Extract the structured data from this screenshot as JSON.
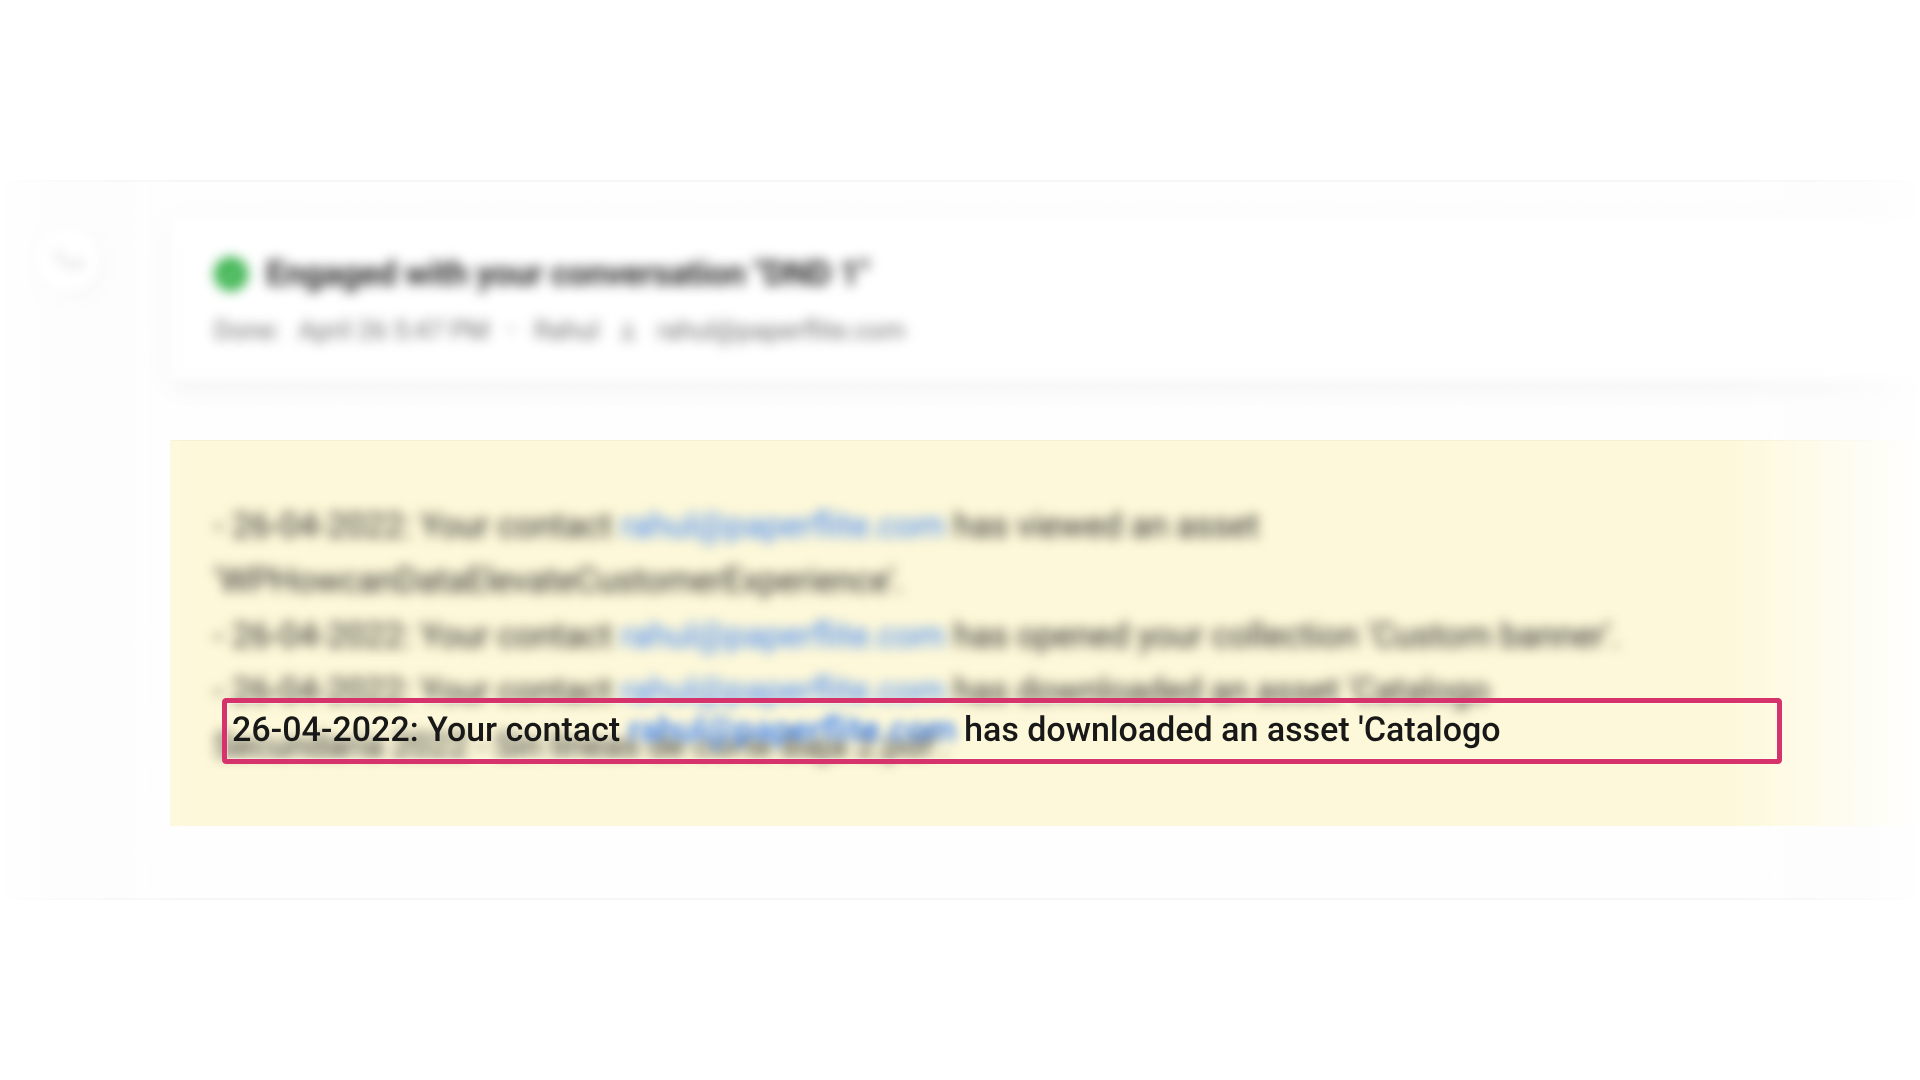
{
  "header": {
    "title": "Engaged with your conversation \"DND 1\"",
    "done_label": "Done:",
    "done_time": "April 26 5:47 PM",
    "owner_name": "Rahul",
    "owner_email": "rahul@paperflite.com"
  },
  "log": {
    "entries": [
      {
        "date": "26-04-2022",
        "intro": "Your contact",
        "email": "rahul@paperflite.com",
        "tail_before_asset": "has viewed an asset",
        "asset": "'WPHowcanDataElevateCustomerExperience'."
      },
      {
        "date": "26-04-2022",
        "intro": "Your contact",
        "email": "rahul@paperflite.com",
        "tail": "has opened your collection 'Custom banner'."
      },
      {
        "date": "26-04-2022",
        "intro": "Your contact",
        "email": "rahul@paperflite.com",
        "tail_before_asset": "has downloaded an asset 'Catalogo",
        "asset_continuation": "Secundaria 2022 - Sin lineas de corte Baja 2.pdf'."
      }
    ]
  },
  "highlight": {
    "date_prefix": "26-04-2022:",
    "intro": "Your contact",
    "email": "rahul@paperflite.com",
    "tail": "has downloaded an asset 'Catalogo"
  },
  "icons": {
    "status": "checkmark-icon",
    "person": "person-icon",
    "phone": "phone-icon"
  }
}
